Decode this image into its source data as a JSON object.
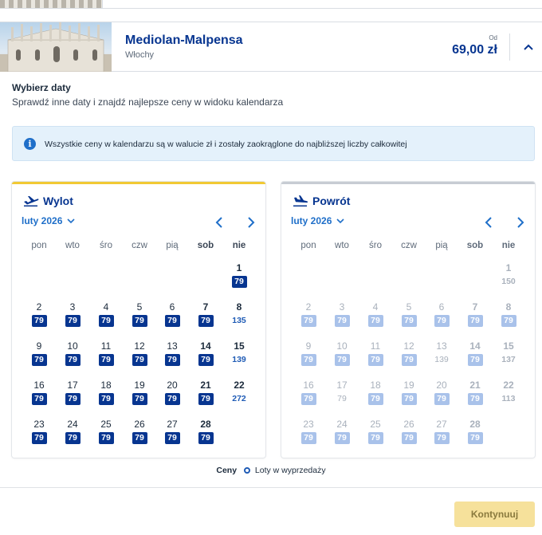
{
  "destination": {
    "name": "Mediolan-Malpensa",
    "country": "Włochy",
    "from_label": "Od",
    "price": "69,00 zł"
  },
  "section": {
    "title": "Wybierz daty",
    "subtitle": "Sprawdź inne daty i znajdź najlepsze ceny w widoku kalendarza"
  },
  "info": {
    "icon": "info-icon",
    "text": "Wszystkie ceny w kalendarzu są w walucie zł i zostały zaokrąglone do najbliższej liczby całkowitej"
  },
  "weekdays": [
    "pon",
    "wto",
    "śro",
    "czw",
    "pią",
    "sob",
    "nie"
  ],
  "outbound": {
    "title": "Wylot",
    "month": "luty 2026",
    "days": [
      {
        "d": "1",
        "p": "79",
        "sale": true
      },
      {
        "d": "2",
        "p": "79",
        "sale": true
      },
      {
        "d": "3",
        "p": "79",
        "sale": true
      },
      {
        "d": "4",
        "p": "79",
        "sale": true
      },
      {
        "d": "5",
        "p": "79",
        "sale": true
      },
      {
        "d": "6",
        "p": "79",
        "sale": true
      },
      {
        "d": "7",
        "p": "79",
        "sale": true
      },
      {
        "d": "8",
        "p": "135",
        "sale": false
      },
      {
        "d": "9",
        "p": "79",
        "sale": true
      },
      {
        "d": "10",
        "p": "79",
        "sale": true
      },
      {
        "d": "11",
        "p": "79",
        "sale": true
      },
      {
        "d": "12",
        "p": "79",
        "sale": true
      },
      {
        "d": "13",
        "p": "79",
        "sale": true
      },
      {
        "d": "14",
        "p": "79",
        "sale": true
      },
      {
        "d": "15",
        "p": "139",
        "sale": false
      },
      {
        "d": "16",
        "p": "79",
        "sale": true
      },
      {
        "d": "17",
        "p": "79",
        "sale": true
      },
      {
        "d": "18",
        "p": "79",
        "sale": true
      },
      {
        "d": "19",
        "p": "79",
        "sale": true
      },
      {
        "d": "20",
        "p": "79",
        "sale": true
      },
      {
        "d": "21",
        "p": "79",
        "sale": true
      },
      {
        "d": "22",
        "p": "272",
        "sale": false
      },
      {
        "d": "23",
        "p": "79",
        "sale": true
      },
      {
        "d": "24",
        "p": "79",
        "sale": true
      },
      {
        "d": "25",
        "p": "79",
        "sale": true
      },
      {
        "d": "26",
        "p": "79",
        "sale": true
      },
      {
        "d": "27",
        "p": "79",
        "sale": true
      },
      {
        "d": "28",
        "p": "79",
        "sale": true
      }
    ]
  },
  "return": {
    "title": "Powrót",
    "month": "luty 2026",
    "days": [
      {
        "d": "1",
        "p": "150",
        "sale": false
      },
      {
        "d": "2",
        "p": "79",
        "sale": true
      },
      {
        "d": "3",
        "p": "79",
        "sale": true
      },
      {
        "d": "4",
        "p": "79",
        "sale": true
      },
      {
        "d": "5",
        "p": "79",
        "sale": true
      },
      {
        "d": "6",
        "p": "79",
        "sale": true
      },
      {
        "d": "7",
        "p": "79",
        "sale": true
      },
      {
        "d": "8",
        "p": "79",
        "sale": true
      },
      {
        "d": "9",
        "p": "79",
        "sale": true
      },
      {
        "d": "10",
        "p": "79",
        "sale": true
      },
      {
        "d": "11",
        "p": "79",
        "sale": true
      },
      {
        "d": "12",
        "p": "79",
        "sale": true
      },
      {
        "d": "13",
        "p": "139",
        "sale": false
      },
      {
        "d": "14",
        "p": "79",
        "sale": true
      },
      {
        "d": "15",
        "p": "137",
        "sale": false
      },
      {
        "d": "16",
        "p": "79",
        "sale": true
      },
      {
        "d": "17",
        "p": "79",
        "sale": false
      },
      {
        "d": "18",
        "p": "79",
        "sale": true
      },
      {
        "d": "19",
        "p": "79",
        "sale": true
      },
      {
        "d": "20",
        "p": "79",
        "sale": true
      },
      {
        "d": "21",
        "p": "79",
        "sale": true
      },
      {
        "d": "22",
        "p": "113",
        "sale": false
      },
      {
        "d": "23",
        "p": "79",
        "sale": true
      },
      {
        "d": "24",
        "p": "79",
        "sale": true
      },
      {
        "d": "25",
        "p": "79",
        "sale": true
      },
      {
        "d": "26",
        "p": "79",
        "sale": true
      },
      {
        "d": "27",
        "p": "79",
        "sale": true
      },
      {
        "d": "28",
        "p": "79",
        "sale": true
      }
    ]
  },
  "legend": {
    "prices_label": "Ceny",
    "sale_label": "Loty w wyprzedaży"
  },
  "continue_label": "Kontynuuj",
  "colors": {
    "brand_navy": "#073590",
    "accent_yellow": "#f1c933",
    "link_blue": "#1f6fc9",
    "disabled_badge": "#a9c2ea",
    "continue_disabled": "#f6e19b"
  }
}
